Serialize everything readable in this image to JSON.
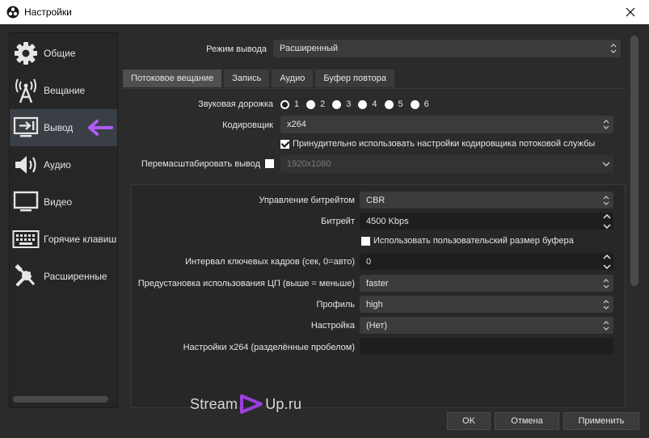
{
  "window": {
    "title": "Настройки"
  },
  "sidebar": {
    "items": [
      {
        "label": "Общие",
        "icon": "gear-icon"
      },
      {
        "label": "Вещание",
        "icon": "broadcast-tower-icon"
      },
      {
        "label": "Вывод",
        "icon": "output-monitor-icon"
      },
      {
        "label": "Аудио",
        "icon": "speaker-icon"
      },
      {
        "label": "Видео",
        "icon": "monitor-icon"
      },
      {
        "label": "Горячие клавиши",
        "icon": "keyboard-icon"
      },
      {
        "label": "Расширенные",
        "icon": "tools-icon"
      }
    ],
    "active_index": 2
  },
  "output": {
    "mode_label": "Режим вывода",
    "mode_value": "Расширенный",
    "tabs": [
      "Потоковое вещание",
      "Запись",
      "Аудио",
      "Буфер повтора"
    ],
    "active_tab": 0,
    "audio_track_label": "Звуковая дорожка",
    "audio_tracks": [
      "1",
      "2",
      "3",
      "4",
      "5",
      "6"
    ],
    "selected_track": "1",
    "encoder_label": "Кодировщик",
    "encoder_value": "x264",
    "enforce_label": "Принудительно использовать настройки кодировщика потоковой службы",
    "enforce_checked": true,
    "rescale_label": "Перемасштабировать вывод",
    "rescale_checked": false,
    "rescale_value": "1920x1080"
  },
  "encoder": {
    "rate_control_label": "Управление битрейтом",
    "rate_control_value": "CBR",
    "bitrate_label": "Битрейт",
    "bitrate_value": "4500 Kbps",
    "custom_buffer_label": "Использовать пользовательский размер буфера",
    "custom_buffer_checked": false,
    "keyframe_label": "Интервал ключевых кадров (сек, 0=авто)",
    "keyframe_value": "0",
    "preset_label": "Предустановка использования ЦП (выше = меньше)",
    "preset_value": "faster",
    "profile_label": "Профиль",
    "profile_value": "high",
    "tune_label": "Настройка",
    "tune_value": "(Нет)",
    "x264opts_label": "Настройки x264 (разделённые пробелом)",
    "x264opts_value": ""
  },
  "buttons": {
    "ok": "OK",
    "cancel": "Отмена",
    "apply": "Применить"
  },
  "watermark": {
    "left": "Stream",
    "right": "Up.ru"
  },
  "colors": {
    "accent_arrow": "#b05cf0",
    "logo": "#9b3fe0"
  }
}
